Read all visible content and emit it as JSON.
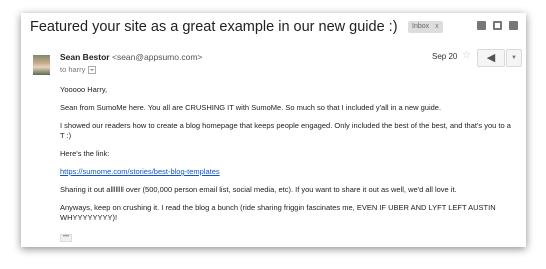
{
  "subject": "Featured your site as a great example in our new guide :)",
  "label": {
    "text": "Inbox",
    "close": "x"
  },
  "toolbar_icons": [
    "download-icon",
    "print-icon",
    "new-window-icon"
  ],
  "sender": {
    "name": "Sean Bestor",
    "email": "<sean@appsumo.com>",
    "to": "to harry"
  },
  "date": "Sep 20",
  "star": "☆",
  "reply_glyph": "◀",
  "more_glyph": "▼",
  "body": {
    "greeting": "Yooooo Harry,",
    "p1": "Sean from SumoMe here. You all are CRUSHING IT with SumoMe. So much so that I included y'all in a new guide.",
    "p2": "I showed our readers how to create a blog homepage that keeps people engaged. Only included the best of the best, and that's you to a T :)",
    "p3": "Here's the link:",
    "link": "https://sumome.com/stories/best-blog-templates",
    "p4": "Sharing it out allllllll over (500,000 person email list, social media, etc). If you want to share it out as well, we'd all love it.",
    "p5": "Anyways, keep on crushing it. I read the blog a bunch (ride sharing friggin fascinates me, EVEN IF UBER AND LYFT LEFT AUSTIN WHYYYYYYYY)!",
    "ellipsis": "•••"
  }
}
